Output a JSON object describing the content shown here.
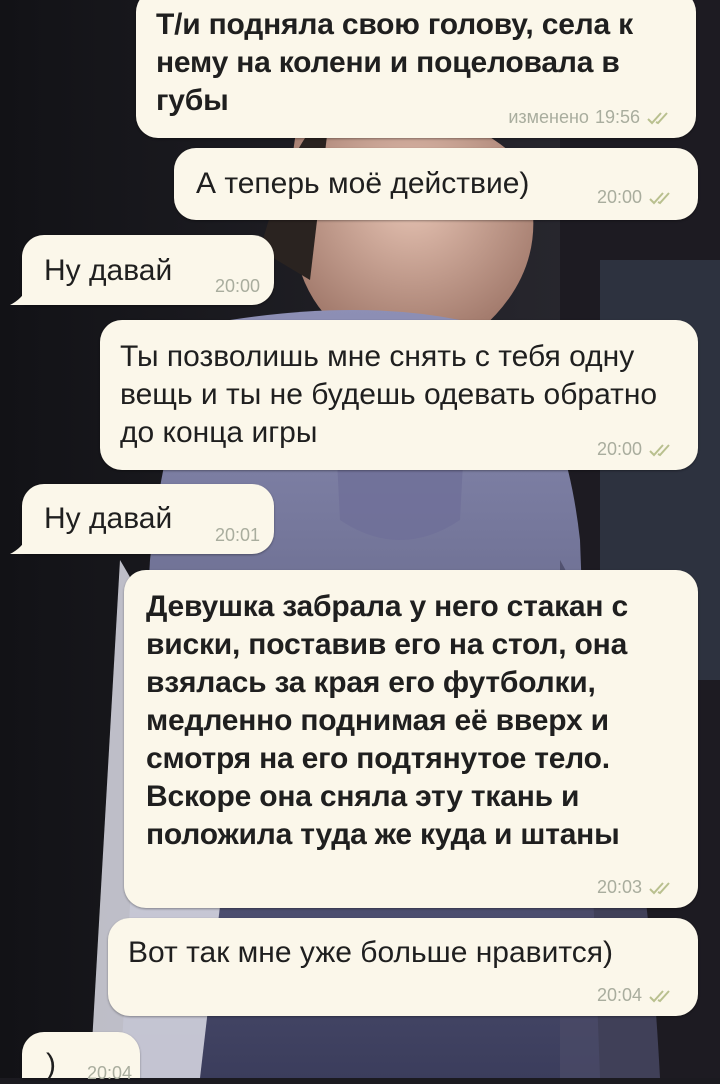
{
  "messages": [
    {
      "direction": "out",
      "text": "Т/и подняла свою голову, села к нему на колени и поцеловала в губы",
      "edited_label": "изменено",
      "time": "19:56",
      "status": "read",
      "bold": true
    },
    {
      "direction": "out",
      "text": "А теперь моё действие)",
      "time": "20:00",
      "status": "read"
    },
    {
      "direction": "in",
      "text": "Ну давай",
      "time": "20:00"
    },
    {
      "direction": "out",
      "text": "Ты позволишь мне снять с тебя одну вещь и ты не будешь одевать обратно до конца игры",
      "time": "20:00",
      "status": "read"
    },
    {
      "direction": "in",
      "text": "Ну давай",
      "time": "20:01"
    },
    {
      "direction": "out",
      "text": "Девушка забрала у него стакан с виски, поставив его на стол, она взялась за края его футболки, медленно поднимая её вверх и смотря на его подтянутое тело. Вскоре она сняла эту ткань и положила туда же куда и штаны",
      "time": "20:03",
      "status": "read",
      "bold": true
    },
    {
      "direction": "out",
      "text": "Вот так мне уже больше нравится)",
      "time": "20:04",
      "status": "read"
    },
    {
      "direction": "in",
      "text": ")",
      "time": "20:04"
    }
  ],
  "colors": {
    "bubble": "#fbf7ea",
    "text": "#1f1f1f",
    "meta": "#a9ad9e",
    "ticks": "#b9c08f"
  },
  "icons": {
    "read_status": "double-check-icon"
  }
}
